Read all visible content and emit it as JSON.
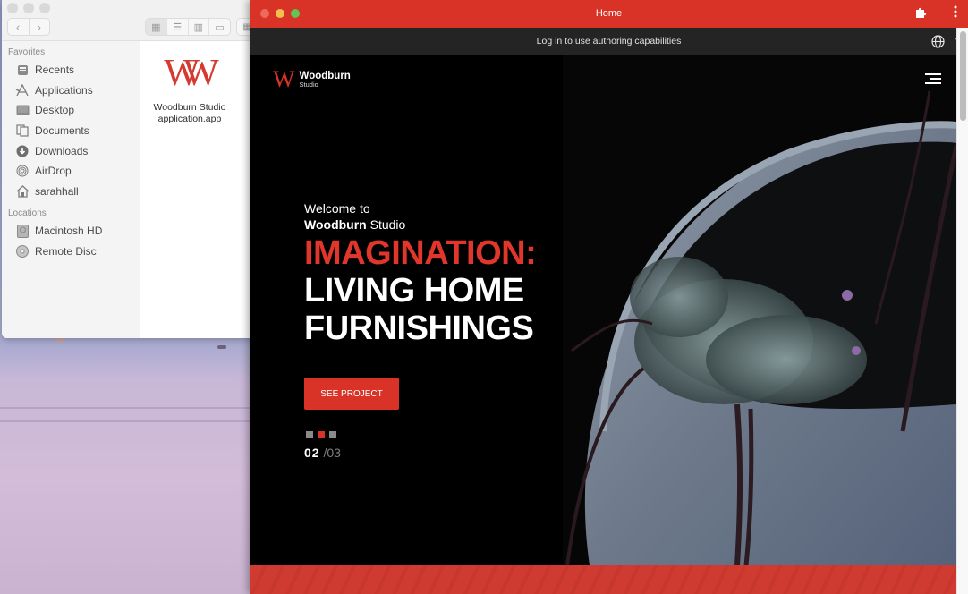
{
  "finder": {
    "nav": {
      "back_icon": "chevron-left-icon",
      "forward_icon": "chevron-right-icon"
    },
    "view_modes": [
      {
        "name": "icon-view",
        "glyph": "▦",
        "active": true
      },
      {
        "name": "list-view",
        "glyph": "☰",
        "active": false
      },
      {
        "name": "column-view",
        "glyph": "▥",
        "active": false
      },
      {
        "name": "gallery-view",
        "glyph": "▭",
        "active": false
      }
    ],
    "sidebar": {
      "favorites_heading": "Favorites",
      "favorites": [
        {
          "label": "Recents",
          "icon": "recents-icon"
        },
        {
          "label": "Applications",
          "icon": "applications-icon"
        },
        {
          "label": "Desktop",
          "icon": "desktop-icon"
        },
        {
          "label": "Documents",
          "icon": "documents-icon"
        },
        {
          "label": "Downloads",
          "icon": "downloads-icon"
        },
        {
          "label": "AirDrop",
          "icon": "airdrop-icon"
        },
        {
          "label": "sarahhall",
          "icon": "home-icon"
        }
      ],
      "locations_heading": "Locations",
      "locations": [
        {
          "label": "Macintosh HD",
          "icon": "hard-drive-icon"
        },
        {
          "label": "Remote Disc",
          "icon": "disc-icon"
        }
      ]
    },
    "files": [
      {
        "icon_glyph": "W",
        "name_line1": "Woodburn Studio",
        "name_line2": "application.app"
      }
    ]
  },
  "app": {
    "title": "Home",
    "titlebar_color": "#d93328",
    "extensions_icon": "puzzle-icon",
    "menu_icon": "kebab-menu-icon",
    "auth_bar": {
      "text": "Log in to use authoring capabilities",
      "language_icon": "globe-icon"
    },
    "site": {
      "logo_glyph": "W",
      "brand_name": "Woodburn",
      "brand_sub": "Studio",
      "menu_icon": "hamburger-icon",
      "hero": {
        "welcome_line1": "Welcome to",
        "welcome_bold": "Woodburn",
        "welcome_rest": " Studio",
        "headline_red": "IMAGINATION:",
        "headline_white_1": "LIVING HOME",
        "headline_white_2": "FURNISHINGS",
        "cta_label": "SEE PROJECT",
        "slides_total": 3,
        "slide_active": 2,
        "counter_current": "02",
        "counter_sep": "/",
        "counter_total": "03"
      },
      "accent_color": "#d93328"
    }
  }
}
